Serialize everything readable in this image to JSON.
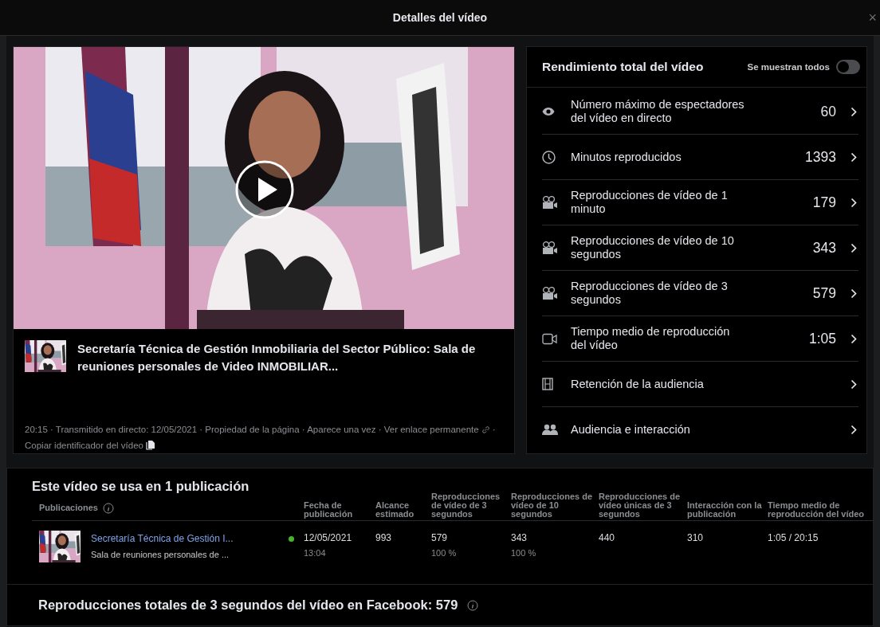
{
  "window": {
    "title": "Detalles del vídeo",
    "close": "×"
  },
  "video": {
    "title": "Secretaría Técnica de Gestión Inmobiliaria del Sector Público: Sala de reuniones personales de Video INMOBILIAR...",
    "meta_text": "20:15 · Transmitido en directo: 12/05/2021 · Propiedad de la página · Aparece una vez ·",
    "permalink": "Ver enlace permanente",
    "separator": "·",
    "copy_id": "Copiar identificador del vídeo"
  },
  "performance": {
    "title": "Rendimiento total del vídeo",
    "toggle_label": "Se muestran todos",
    "toggle_on": false,
    "metrics": [
      {
        "label": "Número máximo de espectadores del vídeo en directo",
        "value": "60"
      },
      {
        "label": "Minutos reproducidos",
        "value": "1393"
      },
      {
        "label": "Reproducciones de vídeo de 1 minuto",
        "value": "179"
      },
      {
        "label": "Reproducciones de vídeo de 10 segundos",
        "value": "343"
      },
      {
        "label": "Reproducciones de vídeo de 3 segundos",
        "value": "579"
      },
      {
        "label": "Tiempo medio de reproducción del vídeo",
        "value": "1:05"
      },
      {
        "label": "Retención de la audiencia"
      },
      {
        "label": "Audiencia e interacción"
      }
    ]
  },
  "usage": {
    "title": "Este vídeo se usa en 1 publicación",
    "columns": [
      "Publicaciones",
      "Fecha de publicación",
      "Alcance estimado",
      "Reproducciones de vídeo de 3 segundos",
      "Reproducciones de vídeo de 10 segundos",
      "Reproducciones de vídeo únicas de 3 segundos",
      "Interacción con la publicación",
      "Tiempo medio de reproducción del vídeo"
    ],
    "rows": [
      {
        "title": "Secretaría Técnica de Gestión I...",
        "subtitle": "Sala de reuniones personales de ...",
        "color": "#42b72a",
        "date": "12/05/2021",
        "time": "13:04",
        "reach": "993",
        "views_3s": "579",
        "views_3s_pct": "100 %",
        "views_10s": "343",
        "views_10s_pct": "100 %",
        "unique_3s": "440",
        "interaction": "310",
        "avg_time": "1:05 / 20:15"
      }
    ]
  },
  "total": {
    "text": "Reproducciones totales de 3 segundos del vídeo en Facebook: 579"
  }
}
